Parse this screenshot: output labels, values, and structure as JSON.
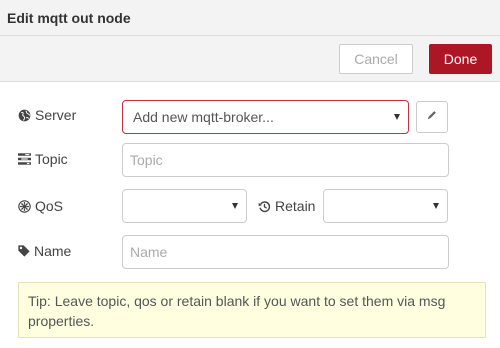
{
  "dialog": {
    "title": "Edit mqtt out node",
    "cancel_label": "Cancel",
    "done_label": "Done",
    "accent_color": "#ad1625"
  },
  "form": {
    "server": {
      "label": "Server",
      "icon": "globe-icon",
      "value": "Add new mqtt-broker...",
      "edit_icon": "pencil-icon"
    },
    "topic": {
      "label": "Topic",
      "icon": "tasks-icon",
      "value": "",
      "placeholder": "Topic"
    },
    "qos": {
      "label": "QoS",
      "icon": "empire-icon",
      "value": ""
    },
    "retain": {
      "label": "Retain",
      "icon": "history-icon",
      "value": ""
    },
    "name": {
      "label": "Name",
      "icon": "tag-icon",
      "value": "",
      "placeholder": "Name"
    }
  },
  "tip": {
    "text": "Tip: Leave topic, qos or retain blank if you want to set them via msg properties."
  }
}
